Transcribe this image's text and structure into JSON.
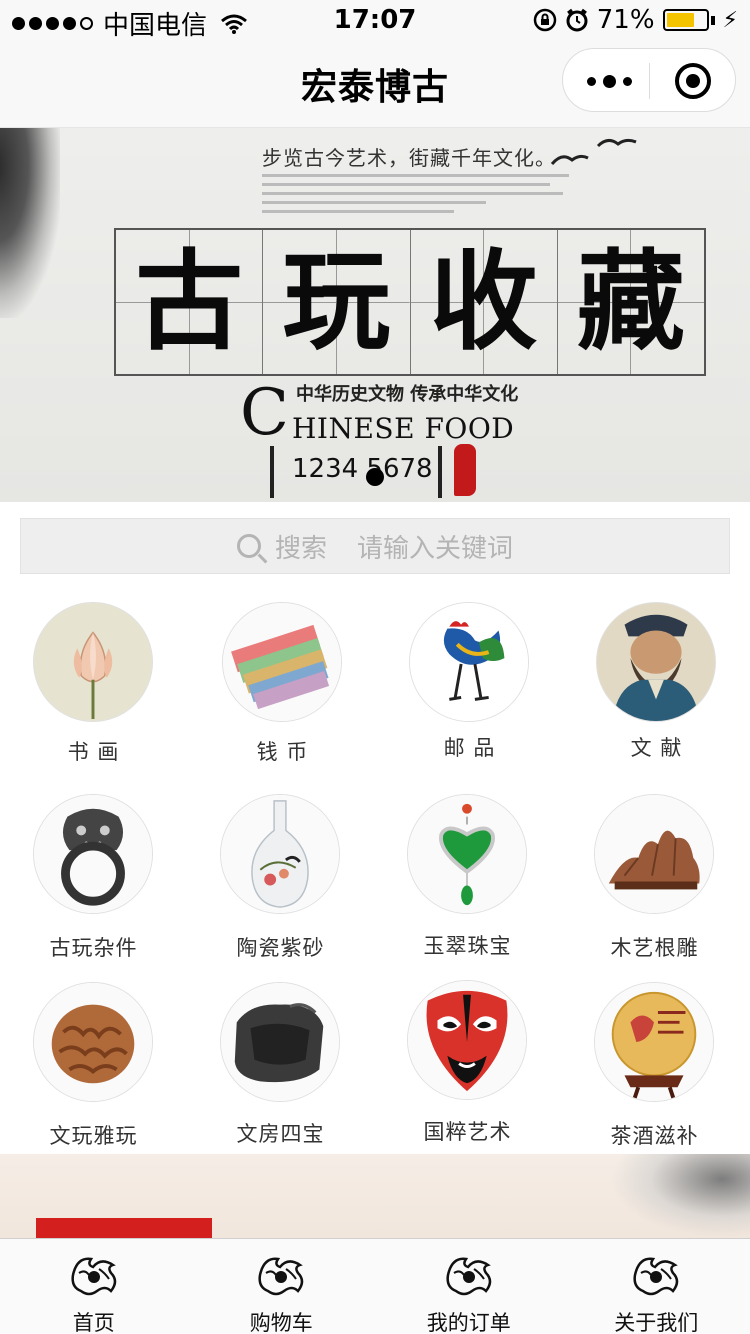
{
  "status_bar": {
    "carrier": "中国电信",
    "time": "17:07",
    "battery_percent": "71%",
    "battery_level": 0.71
  },
  "nav": {
    "title": "宏泰博古"
  },
  "banner": {
    "slogan": "步览古今艺术，街藏千年文化。",
    "title_chars": [
      "古",
      "玩",
      "收",
      "藏"
    ],
    "subtitle": "中华历史文物  传承中华文化",
    "big_letter": "C",
    "english": "HINESE FOOD",
    "number": "1234 5678"
  },
  "search": {
    "label": "搜索",
    "placeholder": "请输入关键词"
  },
  "categories": [
    {
      "label": "书 画",
      "icon": "lotus-painting-icon"
    },
    {
      "label": "钱 币",
      "icon": "banknotes-icon"
    },
    {
      "label": "邮 品",
      "icon": "rooster-stamp-icon"
    },
    {
      "label": "文 献",
      "icon": "confucius-portrait-icon"
    },
    {
      "label": "古玩杂件",
      "icon": "lion-door-knocker-icon"
    },
    {
      "label": "陶瓷紫砂",
      "icon": "porcelain-vase-icon"
    },
    {
      "label": "玉翠珠宝",
      "icon": "jade-pendant-icon"
    },
    {
      "label": "木艺根雕",
      "icon": "root-carving-icon"
    },
    {
      "label": "文玩雅玩",
      "icon": "walnut-icon"
    },
    {
      "label": "文房四宝",
      "icon": "inkstone-icon"
    },
    {
      "label": "国粹艺术",
      "icon": "opera-mask-icon"
    },
    {
      "label": "茶酒滋补",
      "icon": "tea-cake-icon"
    }
  ],
  "tabs": [
    {
      "label": "首页",
      "icon": "dragon-emblem-icon"
    },
    {
      "label": "购物车",
      "icon": "dragon-emblem-icon"
    },
    {
      "label": "我的订单",
      "icon": "dragon-emblem-icon"
    },
    {
      "label": "关于我们",
      "icon": "dragon-emblem-icon"
    }
  ],
  "colors": {
    "battery": "#f5c400",
    "accent_red": "#c21a1a",
    "jade_green": "#1e9a3c"
  }
}
